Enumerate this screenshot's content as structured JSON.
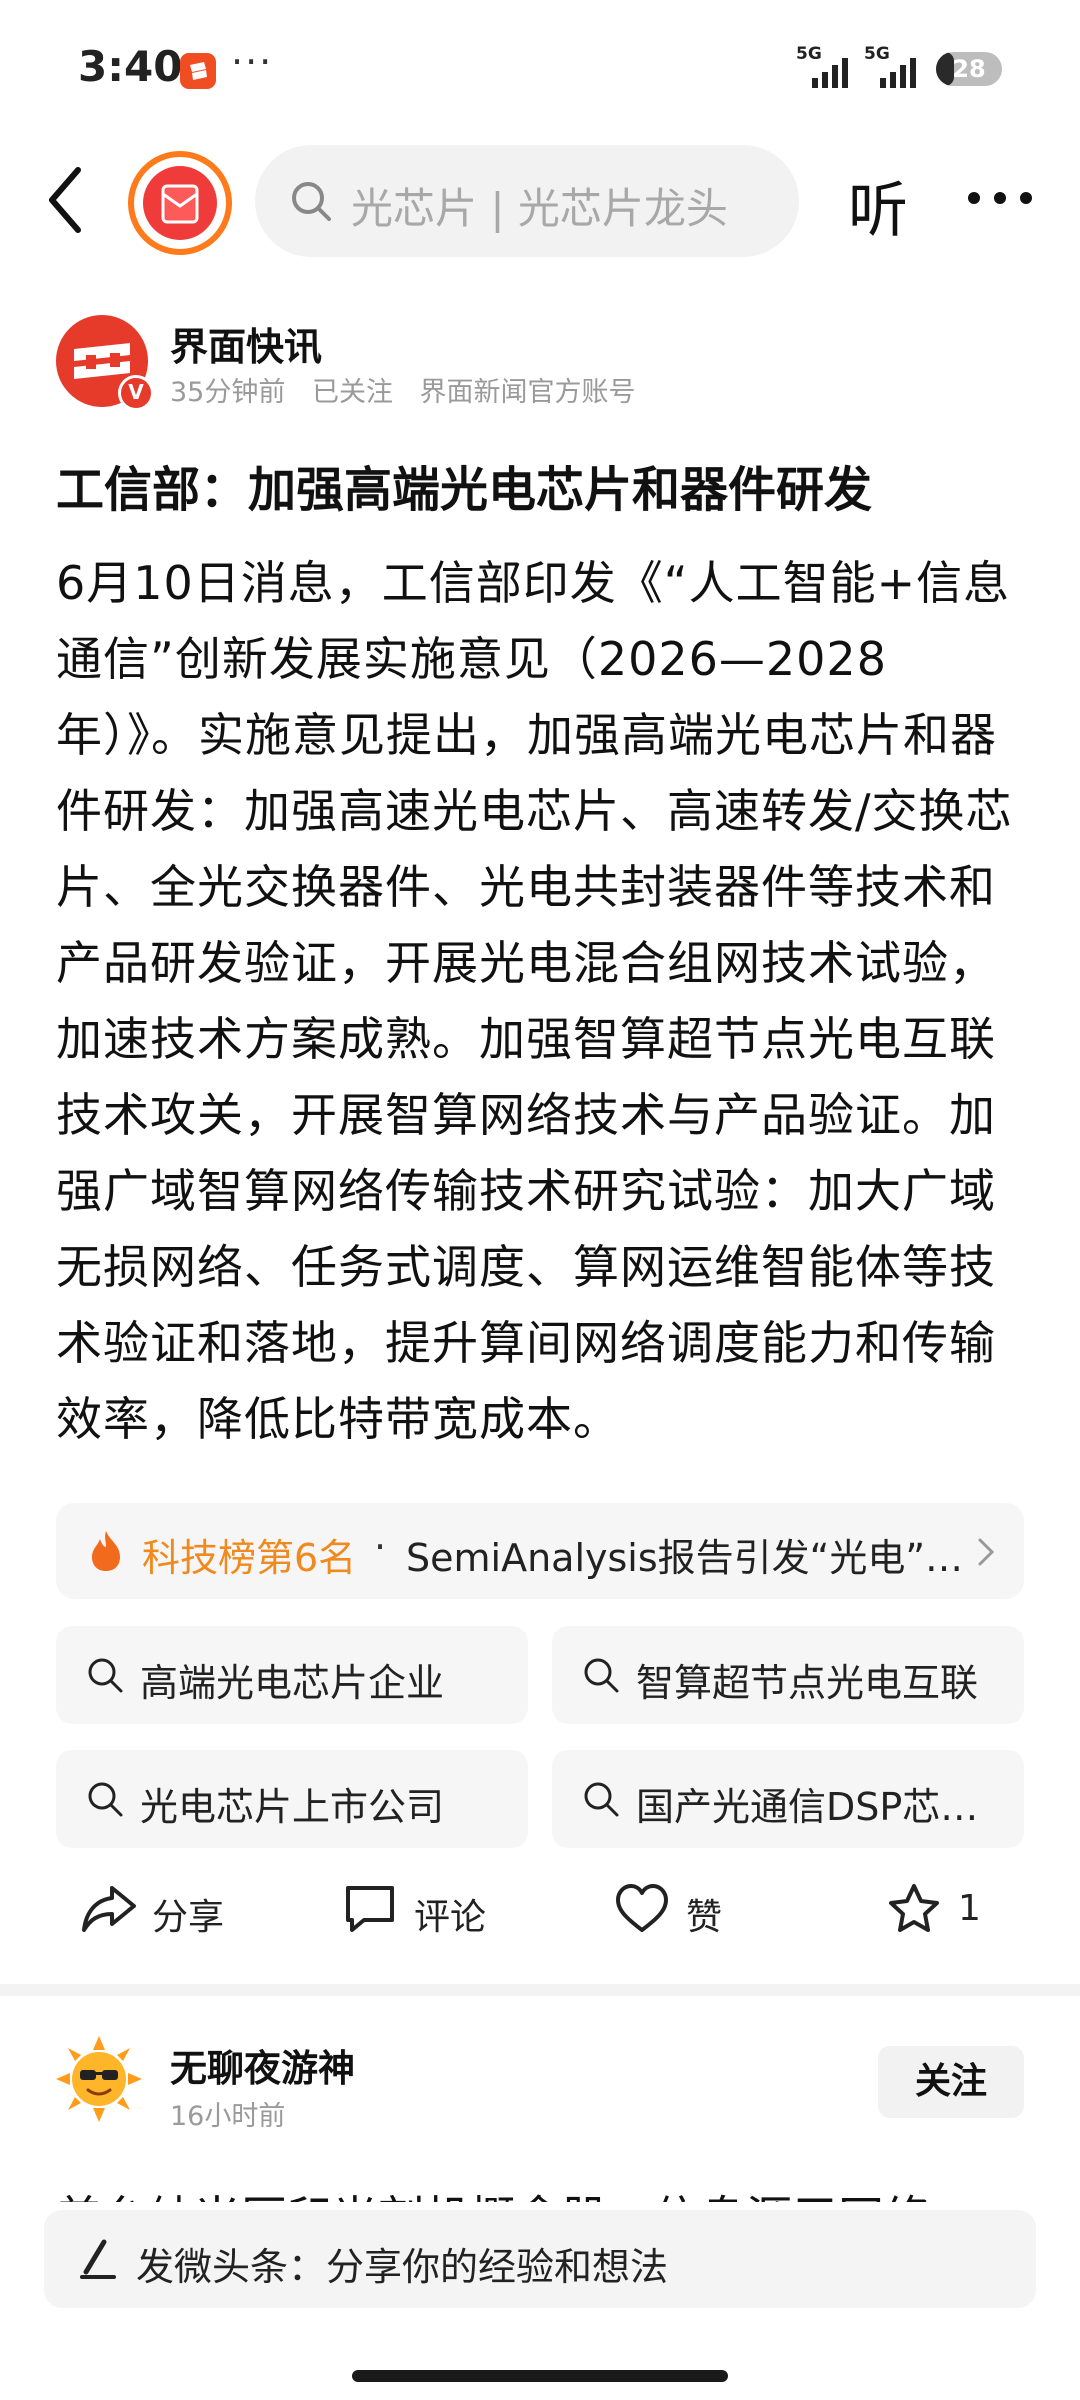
{
  "status_bar": {
    "time": "3:40",
    "more_dots": "···",
    "signal_1_label": "5G",
    "signal_2_label": "5G",
    "battery_level": 28,
    "battery_text": "28"
  },
  "header": {
    "search_placeholder": "光芯片 | 光芯片龙头",
    "listen_label": "听"
  },
  "author": {
    "name": "界面快讯",
    "time": "35分钟前",
    "follow_state": "已关注",
    "account_type": "界面新闻官方账号",
    "verified_badge": "V"
  },
  "article": {
    "title": "工信部：加强高端光电芯片和器件研发",
    "body": "6月10日消息，工信部印发《“人工智能+信息通信”创新发展实施意见（2026—2028年）》。实施意见提出，加强高端光电芯片和器件研发：加强高速光电芯片、高速转发/交换芯片、全光交换器件、光电共封装器件等技术和产品研发验证，开展光电混合组网技术试验，加速技术方案成熟。加强智算超节点光电互联技术攻关，开展智算网络技术与产品验证。加强广域智算网络传输技术研究试验：加大广域无损网络、任务式调度、算网运维智能体等技术验证和落地，提升算间网络调度能力和传输效率，降低比特带宽成本。"
  },
  "trending": {
    "rank_label": "科技榜第6名",
    "separator": "·",
    "text": "SemiAnalysis报告引发“光电”…"
  },
  "related_searches": [
    "高端光电芯片企业",
    "智算超节点光电互联",
    "光电芯片上市公司",
    "国产光通信DSP芯…"
  ],
  "actions": {
    "share": "分享",
    "comment": "评论",
    "like": "赞",
    "favorite_count": "1"
  },
  "next_post": {
    "author": "无聊夜游神",
    "time": "16小时前",
    "follow_label": "关注",
    "preview_text": "美台纳米压印光刻机概念股，信息源于网络"
  },
  "compose": {
    "placeholder": "发微头条：分享你的经验和想法"
  },
  "colors": {
    "accent_orange": "#f08a1e",
    "brand_red": "#e63a2b",
    "logo_ring": "#ff7a1a"
  }
}
